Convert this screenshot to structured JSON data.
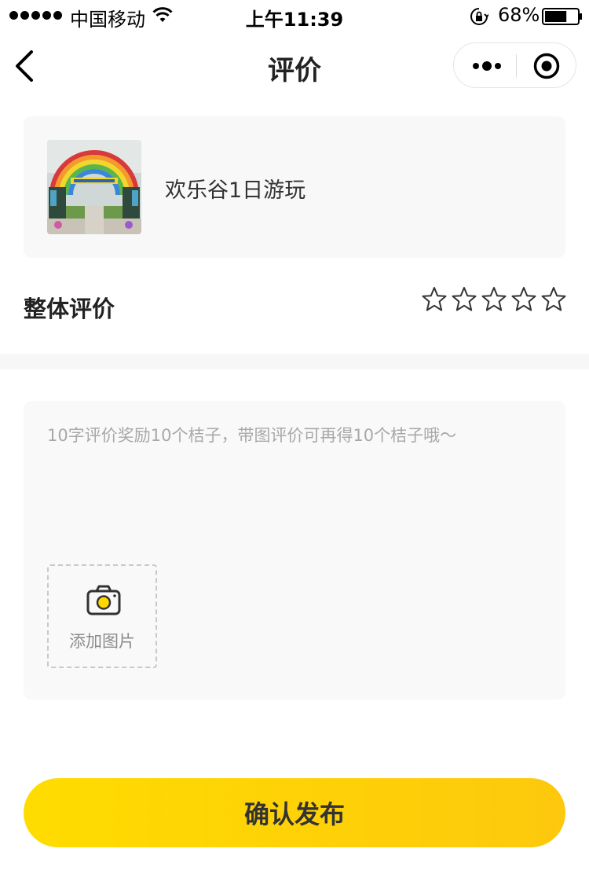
{
  "status_bar": {
    "carrier": "中国移动",
    "time": "上午11:39",
    "battery_percent": "68%",
    "battery_level": 0.68,
    "icons": [
      "signal-dots-icon",
      "wifi-icon",
      "rotation-lock-icon",
      "battery-icon"
    ]
  },
  "nav": {
    "title": "评价",
    "icons": [
      "back-chevron-icon",
      "more-dots-icon",
      "target-icon"
    ]
  },
  "product": {
    "name": "欢乐谷1日游玩",
    "thumbnail": "theme-park-gate-photo"
  },
  "rating": {
    "label": "整体评价",
    "max_stars": 5,
    "selected_stars": 0
  },
  "comment": {
    "placeholder": "10字评价奖励10个桔子，带图评价可再得10个桔子哦～",
    "value": ""
  },
  "add_photo": {
    "label": "添加图片",
    "icon": "camera-icon"
  },
  "submit": {
    "label": "确认发布"
  },
  "colors": {
    "accent_start": "#ffdc00",
    "accent_end": "#fdc80d",
    "card_background": "#f8f8f8",
    "placeholder_text": "#a8a8a8"
  }
}
